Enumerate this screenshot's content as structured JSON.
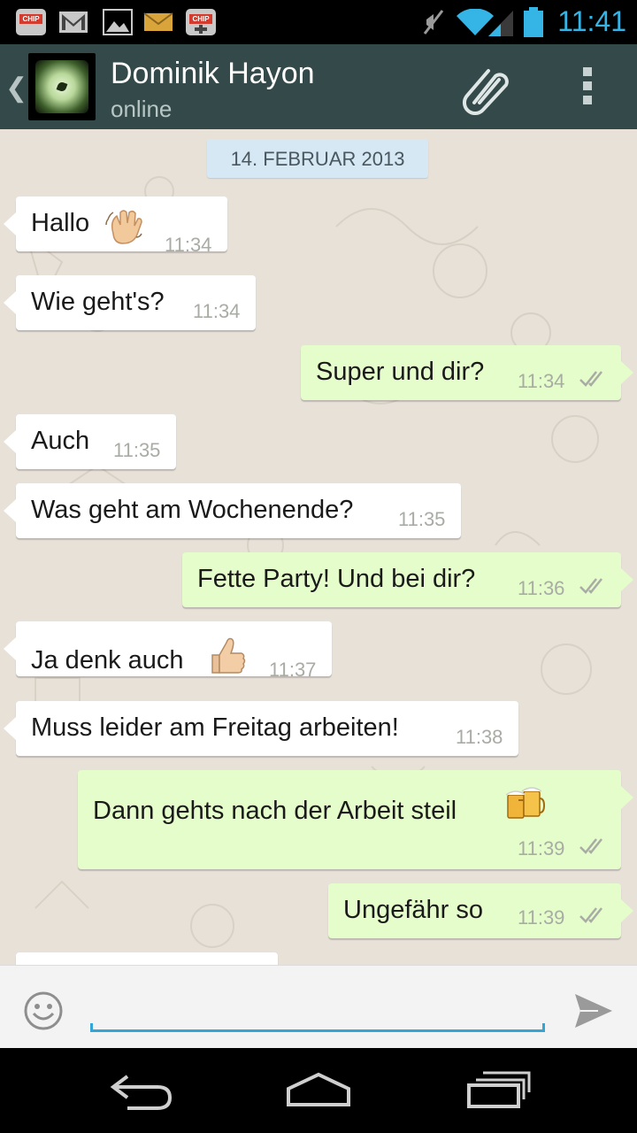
{
  "status_bar": {
    "clock": "11:41",
    "notification_icons": [
      "chip-app-icon",
      "gmail-icon",
      "gallery-icon",
      "email-icon",
      "chip-game-icon"
    ],
    "system_icons": [
      "mute-icon",
      "wifi-icon",
      "signal-icon",
      "battery-icon"
    ],
    "chip_label": "CHIP",
    "accent_color": "#35b5e5"
  },
  "header": {
    "contact_name": "Dominik Hayon",
    "status": "online",
    "background_color": "#34494a"
  },
  "date_separator": "14. FEBRUAR 2013",
  "messages": [
    {
      "direction": "in",
      "text": "Hallo",
      "emoji": "waving-hand-emoji",
      "time": "11:34"
    },
    {
      "direction": "in",
      "text": "Wie geht's?",
      "time": "11:34"
    },
    {
      "direction": "out",
      "text": "Super und dir?",
      "time": "11:34"
    },
    {
      "direction": "in",
      "text": "Auch",
      "time": "11:35"
    },
    {
      "direction": "in",
      "text": "Was geht am Wochenende?",
      "time": "11:35"
    },
    {
      "direction": "out",
      "text": "Fette Party! Und bei dir?",
      "time": "11:36"
    },
    {
      "direction": "in",
      "text": "Ja denk auch",
      "emoji": "thumbs-up-emoji",
      "time": "11:37"
    },
    {
      "direction": "in",
      "text": "Muss leider am Freitag arbeiten!",
      "time": "11:38"
    },
    {
      "direction": "out",
      "text": "Dann gehts nach der Arbeit steil",
      "emoji": "beer-mugs-emoji",
      "time": "11:39"
    },
    {
      "direction": "out",
      "text": "Ungefähr so",
      "time": "11:39"
    }
  ],
  "input": {
    "value": "",
    "placeholder": ""
  },
  "colors": {
    "incoming_bubble": "#ffffff",
    "outgoing_bubble": "#e5fccb",
    "chat_background": "#e7e1d8",
    "date_pill": "#d6e8f3",
    "input_underline": "#33a6d6"
  }
}
